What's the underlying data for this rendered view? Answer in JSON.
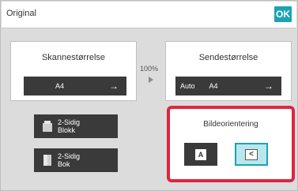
{
  "header": {
    "title": "Original",
    "ok_label": "OK"
  },
  "scan_size": {
    "title": "Skannestørrelse",
    "value": "A4"
  },
  "zoom": {
    "text": "100%"
  },
  "send_size": {
    "title": "Sendestørrelse",
    "mode": "Auto",
    "value": "A4"
  },
  "buttons": {
    "two_sided_book": "2-Sidig\nBlokk",
    "two_sided_tablet": "2-Sidig\nBok"
  },
  "orientation": {
    "title": "Bildeorientering",
    "portrait_glyph": "A",
    "landscape_glyph": "<"
  },
  "colors": {
    "accent": "#1ba3b5",
    "highlight": "#e0263c"
  }
}
